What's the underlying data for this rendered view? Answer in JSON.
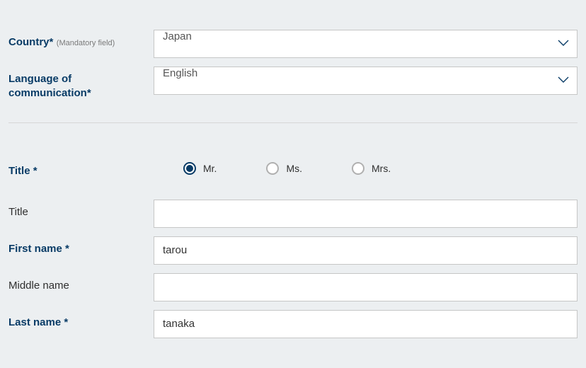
{
  "fields": {
    "country": {
      "label": "Country*",
      "hint": "(Mandatory field)",
      "value": "Japan"
    },
    "language": {
      "label": "Language of communication*",
      "value": "English"
    },
    "title_radio": {
      "label": "Title *",
      "options": [
        {
          "key": "mr",
          "label": "Mr.",
          "selected": true
        },
        {
          "key": "ms",
          "label": "Ms.",
          "selected": false
        },
        {
          "key": "mrs",
          "label": "Mrs.",
          "selected": false
        }
      ]
    },
    "title_text": {
      "label": "Title",
      "value": ""
    },
    "first_name": {
      "label": "First name *",
      "value": "tarou"
    },
    "middle_name": {
      "label": "Middle name",
      "value": ""
    },
    "last_name": {
      "label": "Last name *",
      "value": "tanaka"
    }
  }
}
